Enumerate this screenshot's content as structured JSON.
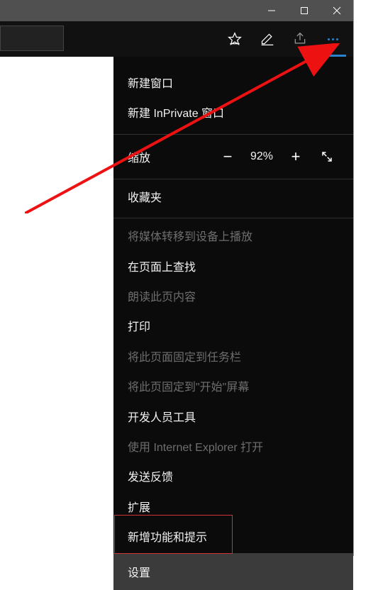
{
  "menu": {
    "new_window": "新建窗口",
    "new_inprivate": "新建 InPrivate 窗口",
    "zoom_label": "缩放",
    "zoom_value": "92%",
    "favorites": "收藏夹",
    "cast_media": "将媒体转移到设备上播放",
    "find_on_page": "在页面上查找",
    "read_aloud": "朗读此页内容",
    "print": "打印",
    "pin_taskbar": "将此页面固定到任务栏",
    "pin_start": "将此页固定到\"开始\"屏幕",
    "dev_tools": "开发人员工具",
    "open_ie": "使用 Internet Explorer 打开",
    "send_feedback": "发送反馈",
    "extensions": "扩展",
    "whats_new": "新增功能和提示",
    "settings": "设置"
  }
}
